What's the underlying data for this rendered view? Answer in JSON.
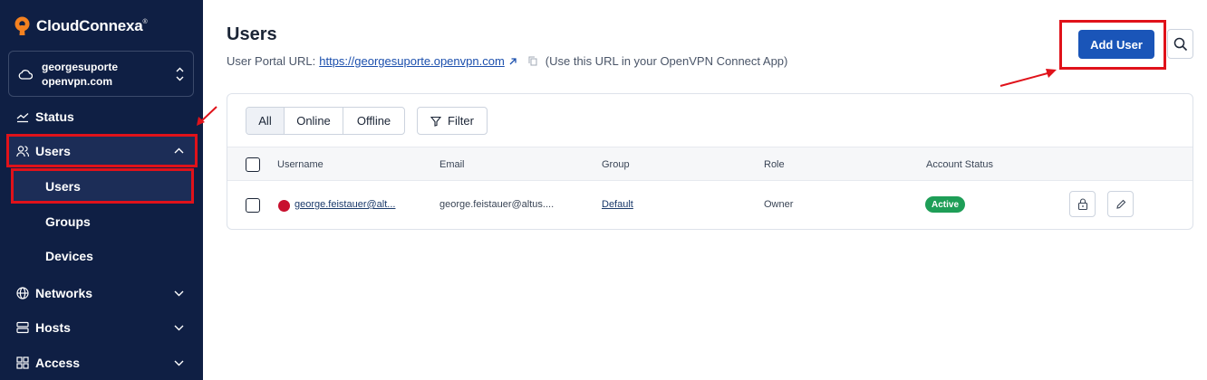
{
  "brand": {
    "name": "CloudConnexa",
    "mark": "®"
  },
  "org": {
    "line1": "georgesuporte",
    "line2": "openvpn.com"
  },
  "nav": {
    "status": "Status",
    "users": "Users",
    "users_sub": [
      "Users",
      "Groups",
      "Devices"
    ],
    "networks": "Networks",
    "hosts": "Hosts",
    "access": "Access"
  },
  "page": {
    "title": "Users",
    "portal_label": "User Portal URL:",
    "portal_url": "https://georgesuporte.openvpn.com",
    "portal_hint": "(Use this URL in your OpenVPN Connect App)",
    "add_user": "Add User"
  },
  "filters": {
    "tabs": [
      "All",
      "Online",
      "Offline"
    ],
    "active": "All",
    "filter_label": "Filter"
  },
  "table": {
    "columns": [
      "Username",
      "Email",
      "Group",
      "Role",
      "Account Status"
    ],
    "rows": [
      {
        "username": "george.feistauer@alt...",
        "email": "george.feistauer@altus....",
        "group": "Default",
        "role": "Owner",
        "status": "Active"
      }
    ]
  },
  "colors": {
    "sidebar_bg": "#0f1f44",
    "primary": "#1a55b8",
    "active_badge": "#1e9e57",
    "annotation_red": "#e0121a",
    "user_dot": "#c8102e"
  }
}
